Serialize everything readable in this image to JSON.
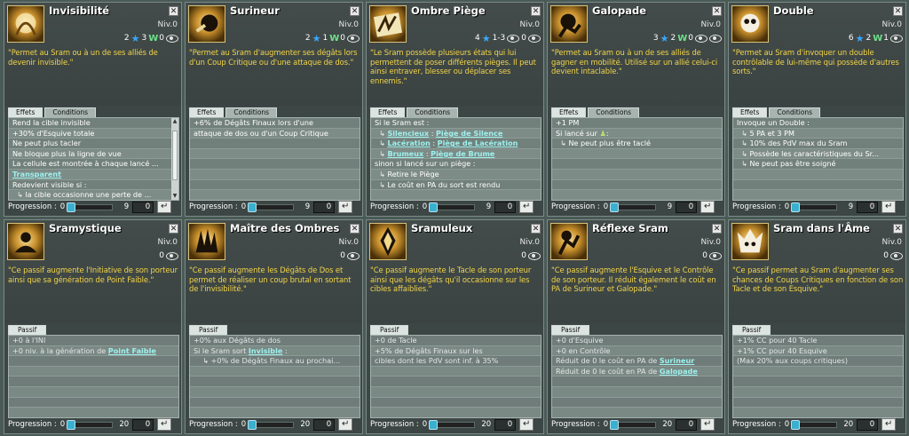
{
  "cards": [
    {
      "name": "Invisibilité",
      "icon": "invisibility-icon",
      "niv": "Niv.0",
      "pa": "2",
      "pw": "3",
      "po": "0",
      "description": "\"Permet au Sram ou à un de ses alliés de devenir invisible.\"",
      "tabs": [
        "Effets",
        "Conditions"
      ],
      "lines": [
        "Rend la cible invisible",
        "+30% d'Esquive totale",
        "Ne peut plus tacler",
        "Ne bloque plus la ligne de vue",
        "La cellule est montrée à chaque lancé ...",
        "Transparent",
        "Redevient visible si :",
        "la cible occasionne une perte de ..."
      ],
      "progress": {
        "label": "Progression :",
        "value": "0",
        "max": "9",
        "box": "0"
      }
    },
    {
      "name": "Surineur",
      "icon": "surineur-icon",
      "niv": "Niv.0",
      "pa": "2",
      "pw": "1",
      "po": "0",
      "description": "\"Permet au Sram d'augmenter ses dégâts lors d'un Coup Critique ou d'une attaque de dos.\"",
      "tabs": [
        "Effets",
        "Conditions"
      ],
      "lines": [
        "+6% de Dégâts Finaux lors d'une",
        "attaque de dos ou d'un Coup Critique"
      ],
      "progress": {
        "label": "Progression :",
        "value": "0",
        "max": "9",
        "box": "0"
      }
    },
    {
      "name": "Ombre Piège",
      "icon": "trap-icon",
      "niv": "Niv.0",
      "pa": "4",
      "range": "1-3",
      "po": "0",
      "description": "\"Le Sram possède plusieurs états qui lui permettent de poser différents pièges. Il peut ainsi entraver, blesser ou déplacer ses ennemis.\"",
      "tabs": [
        "Effets",
        "Conditions"
      ],
      "lines": [
        "Si le Sram est :",
        "Silencieux",
        "Piège de Silence",
        "Lacération",
        "Piège de Lacération",
        "Brumeux",
        "Piège de Brume",
        "sinon si lancé sur un piège :",
        "Retire le Piège",
        "Le coût en PA du sort est rendu"
      ],
      "progress": {
        "label": "Progression :",
        "value": "0",
        "max": "9",
        "box": "0"
      }
    },
    {
      "name": "Galopade",
      "icon": "galopade-icon",
      "niv": "Niv.0",
      "pa": "3",
      "pw": "2",
      "po": "0",
      "description": "\"Permet au Sram ou à un de ses alliés de gagner en mobilité. Utilisé sur un allié celui-ci devient intaclable.\"",
      "tabs": [
        "Effets",
        "Conditions"
      ],
      "lines": [
        "+1 PM",
        "Si lancé sur",
        "Ne peut plus être taclé"
      ],
      "progress": {
        "label": "Progression :",
        "value": "0",
        "max": "9",
        "box": "0"
      }
    },
    {
      "name": "Double",
      "icon": "double-icon",
      "niv": "Niv.0",
      "pa": "6",
      "pw": "2",
      "po": "1",
      "description": "\"Permet au Sram d'invoquer un double contrôlable de lui-même qui possède d'autres sorts.\"",
      "tabs": [
        "Effets",
        "Conditions"
      ],
      "lines": [
        "Invoque un Double :",
        "5 PA et 3 PM",
        "10% des PdV max du Sram",
        "Possède les caractéristiques du Sr...",
        "Ne peut pas être soigné"
      ],
      "progress": {
        "label": "Progression :",
        "value": "0",
        "max": "9",
        "box": "0"
      }
    },
    {
      "name": "Sramystique",
      "icon": "sramystique-icon",
      "niv": "Niv.0",
      "po": "0",
      "description": "\"Ce passif augmente l'Initiative de son porteur ainsi que sa génération de Point Faible.\"",
      "tabs": [
        "Passif"
      ],
      "lines": [
        "+0 à l'INI",
        "+0 niv. à la génération de",
        "Point Faible"
      ],
      "progress": {
        "label": "Progression :",
        "value": "0",
        "max": "20",
        "box": "0"
      }
    },
    {
      "name": "Maître des Ombres",
      "icon": "shadow-master-icon",
      "niv": "Niv.0",
      "po": "0",
      "description": "\"Ce passif augmente les Dégâts de Dos et permet de réaliser un coup brutal en sortant de l'invisibilité.\"",
      "tabs": [
        "Passif"
      ],
      "lines": [
        "+0% aux Dégâts de dos",
        "Si le Sram sort",
        "Invisible",
        "+0% de Dégâts Finaux au prochai..."
      ],
      "progress": {
        "label": "Progression :",
        "value": "0",
        "max": "20",
        "box": "0"
      }
    },
    {
      "name": "Sramuleux",
      "icon": "sramuleux-icon",
      "niv": "Niv.0",
      "po": "0",
      "description": "\"Ce passif augmente le Tacle de son porteur ainsi que les dégâts qu'il occasionne sur les cibles affaiblies.\"",
      "tabs": [
        "Passif"
      ],
      "lines": [
        "+0 de Tacle",
        "+5% de Dégâts Finaux sur les",
        "cibles dont les PdV sont inf. à 35%"
      ],
      "progress": {
        "label": "Progression :",
        "value": "0",
        "max": "20",
        "box": "0"
      }
    },
    {
      "name": "Réflexe Sram",
      "icon": "reflex-icon",
      "niv": "Niv.0",
      "po": "0",
      "description": "\"Ce passif augmente l'Esquive et le Contrôle de son porteur. Il réduit également le coût en PA de Surineur et Galopade.\"",
      "tabs": [
        "Passif"
      ],
      "lines": [
        "+0 d'Esquive",
        "+0 en Contrôle",
        "Réduit de 0 le coût en PA de",
        "Surineur",
        "Réduit de 0 le coût en PA de",
        "Galopade"
      ],
      "progress": {
        "label": "Progression :",
        "value": "0",
        "max": "20",
        "box": "0"
      }
    },
    {
      "name": "Sram dans l'Âme",
      "icon": "soul-icon",
      "niv": "Niv.0",
      "po": "0",
      "description": "\"Ce passif permet au Sram d'augmenter ses chances de Coups Critiques en fonction de son Tacle et de son Esquive.\"",
      "tabs": [
        "Passif"
      ],
      "lines": [
        "+1% CC pour 40 Tacle",
        "+1% CC pour 40 Esquive",
        "(Max 20% aux coups critiques)"
      ],
      "progress": {
        "label": "Progression :",
        "value": "0",
        "max": "20",
        "box": "0"
      }
    }
  ]
}
